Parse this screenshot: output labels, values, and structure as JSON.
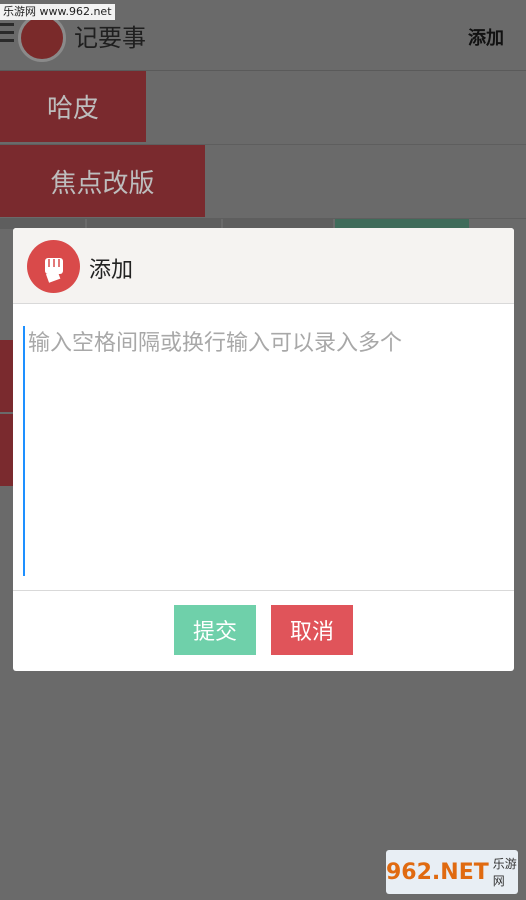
{
  "watermark": {
    "top_text": "乐游网 www.962.net",
    "bottom_brand": "962.NET",
    "bottom_sub": "乐游网"
  },
  "app": {
    "title": "记要事",
    "add_action": "添加",
    "tags": [
      "哈皮",
      "焦点改版"
    ]
  },
  "dialog": {
    "title": "添加",
    "input": {
      "value": "",
      "placeholder": "输入空格间隔或换行输入可以录入多个"
    },
    "submit_label": "提交",
    "cancel_label": "取消"
  },
  "colors": {
    "accent_red": "#e0545a",
    "submit_green": "#6fd0aa",
    "overlay": "#6a6a6a"
  },
  "icons": [
    "menu-icon",
    "fist-logo-icon"
  ]
}
